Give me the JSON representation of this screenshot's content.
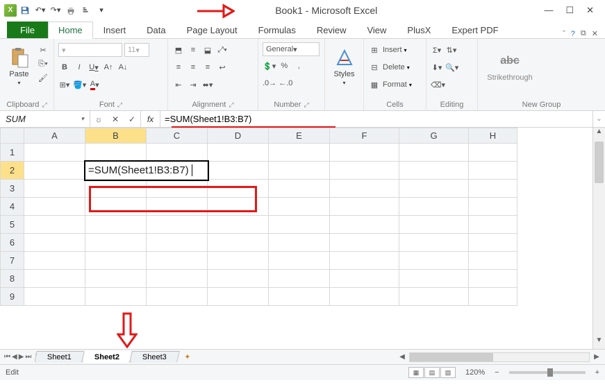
{
  "title": "Book1  -  Microsoft Excel",
  "tabs": {
    "file": "File",
    "home": "Home",
    "insert": "Insert",
    "data": "Data",
    "pagelayout": "Page Layout",
    "formulas": "Formulas",
    "review": "Review",
    "view": "View",
    "plusx": "PlusX",
    "expert": "Expert PDF"
  },
  "ribbon": {
    "clipboard": {
      "paste": "Paste",
      "label": "Clipboard"
    },
    "font": {
      "size": "11",
      "bold": "B",
      "italic": "I",
      "underline": "U",
      "label": "Font"
    },
    "alignment": {
      "label": "Alignment"
    },
    "number": {
      "format": "General",
      "label": "Number"
    },
    "styles": {
      "btn": "Styles",
      "label": ""
    },
    "cells": {
      "insert": "Insert",
      "delete": "Delete",
      "format": "Format",
      "label": "Cells"
    },
    "editing": {
      "label": "Editing"
    },
    "newgroup": {
      "strike": "Strikethrough",
      "label": "New Group"
    }
  },
  "namebox": "SUM",
  "fx": {
    "cancel": "✕",
    "enter": "✓",
    "label": "fx"
  },
  "formula": "=SUM(Sheet1!B3:B7)",
  "cell_formula": "=SUM(Sheet1!B3:B7)",
  "columns": [
    "A",
    "B",
    "C",
    "D",
    "E",
    "F",
    "G",
    "H"
  ],
  "rows": [
    "1",
    "2",
    "3",
    "4",
    "5",
    "6",
    "7",
    "8",
    "9"
  ],
  "active_col_index": 1,
  "active_row_index": 1,
  "sheets": {
    "s1": "Sheet1",
    "s2": "Sheet2",
    "s3": "Sheet3"
  },
  "status": {
    "mode": "Edit",
    "zoom": "120%",
    "minus": "−",
    "plus": "+"
  }
}
